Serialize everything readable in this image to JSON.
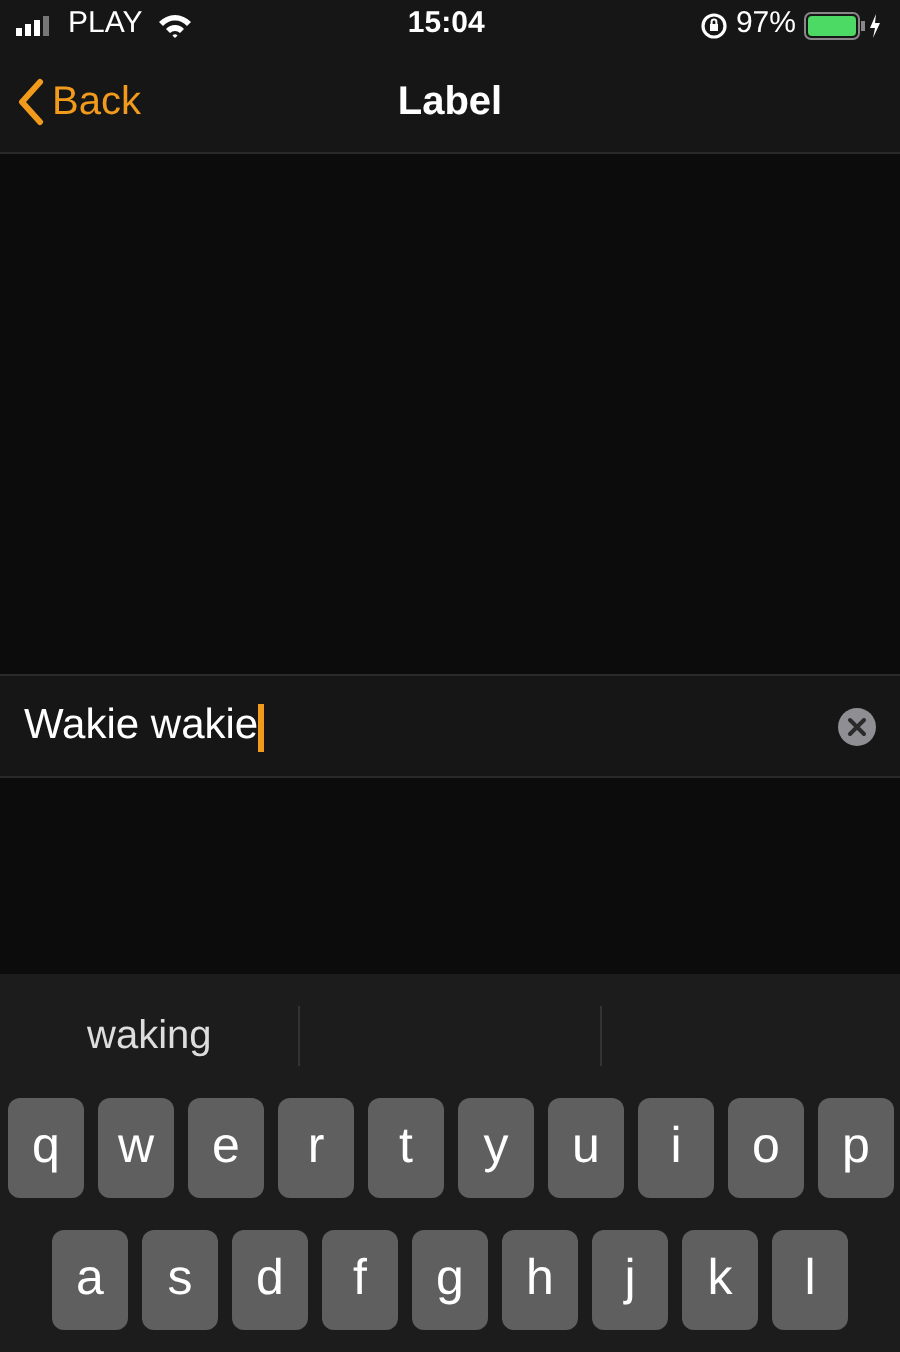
{
  "status_bar": {
    "carrier": "PLAY",
    "time": "15:04",
    "battery": "97%"
  },
  "nav_bar": {
    "back": "Back",
    "title": "Label"
  },
  "text_field": {
    "value": "Wakie wakie"
  },
  "keyboard": {
    "suggestions": [
      "waking"
    ],
    "rows": [
      [
        "q",
        "w",
        "e",
        "r",
        "t",
        "y",
        "u",
        "i",
        "o",
        "p"
      ],
      [
        "a",
        "s",
        "d",
        "f",
        "g",
        "h",
        "j",
        "k",
        "l"
      ]
    ]
  }
}
